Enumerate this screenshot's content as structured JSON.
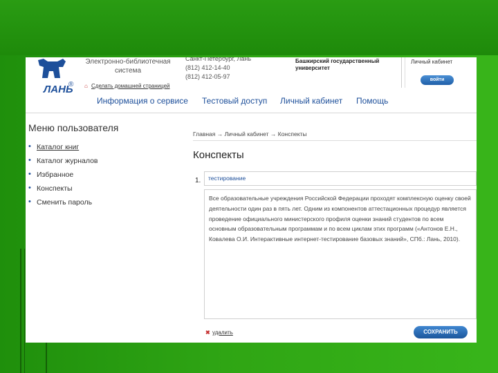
{
  "header": {
    "logo_text": "ЛАНЬ",
    "logo_mark": "®",
    "site_name_line1": "Электронно-библиотечная",
    "site_name_line2": "система",
    "homepage_link": "Сделать домашней страницей",
    "contacts_line1": "Санкт-Петербург, Лань",
    "phone1": "(812) 412-14-40",
    "phone2": "(812) 412-05-97",
    "university_line1": "Башкирский государственный",
    "university_line2": "университет",
    "cabinet_label": "Личный кабинет",
    "login_button": "войти"
  },
  "nav": {
    "items": [
      "Информация о сервисе",
      "Тестовый доступ",
      "Личный кабинет",
      "Помощь"
    ]
  },
  "sidebar": {
    "title": "Меню пользователя",
    "items": [
      {
        "label": "Каталог книг",
        "link": true
      },
      {
        "label": "Каталог журналов",
        "link": false
      },
      {
        "label": "Избранное",
        "link": false
      },
      {
        "label": "Конспекты",
        "link": false
      },
      {
        "label": "Сменить пароль",
        "link": false
      }
    ]
  },
  "main": {
    "breadcrumb": "Главная → Личный кабинет → Конспекты",
    "title": "Конспекты",
    "note_number": "1.",
    "note_title": "тестирование",
    "note_body": "Все образовательные учреждения Российской Федерации проходят комплексную оценку своей деятельности один раз в пять лет. Одним из компонентов аттестационных процедур является проведение официального министерского профиля оценки знаний студентов по всем основным образовательным программам и по всем циклам этих программ («Антонов Е.Н., Ковалева О.И. Интерактивные интернет-тестирование базовых знаний», СПб.: Лань, 2010).",
    "delete_link": "удалить",
    "save_button": "СОХРАНИТЬ"
  }
}
